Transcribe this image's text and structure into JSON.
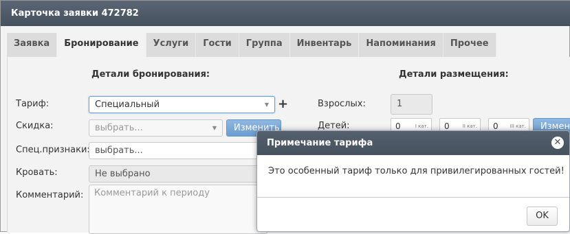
{
  "window": {
    "title": "Карточка заявки 472782"
  },
  "tabs": [
    {
      "label": "Заявка"
    },
    {
      "label": "Бронирование"
    },
    {
      "label": "Услуги"
    },
    {
      "label": "Гости"
    },
    {
      "label": "Группа"
    },
    {
      "label": "Инвентарь"
    },
    {
      "label": "Напоминания"
    },
    {
      "label": "Прочее"
    }
  ],
  "booking": {
    "title": "Детали бронирования:",
    "tariff_label": "Тариф:",
    "tariff_value": "Специальный",
    "discount_label": "Скидка:",
    "discount_placeholder": "выбрать...",
    "change_button": "Изменить",
    "special_label": "Спец.признаки:",
    "special_placeholder": "выбрать...",
    "bed_label": "Кровать:",
    "bed_value": "Не выбрано",
    "comment_label": "Комментарий:",
    "comment_placeholder": "Комментарий к периоду"
  },
  "placement": {
    "title": "Детали размещения:",
    "adults_label": "Взрослых:",
    "adults_value": "1",
    "children_label": "Детей:",
    "children": [
      {
        "value": "0",
        "cat": "I кат."
      },
      {
        "value": "0",
        "cat": "II кат."
      },
      {
        "value": "0",
        "cat": "III кат."
      }
    ],
    "change_button": "Изменить"
  },
  "dialog": {
    "title": "Примечание тарифа",
    "message": "Это особенный тариф только для привилегированных гостей!",
    "ok_label": "OK"
  }
}
